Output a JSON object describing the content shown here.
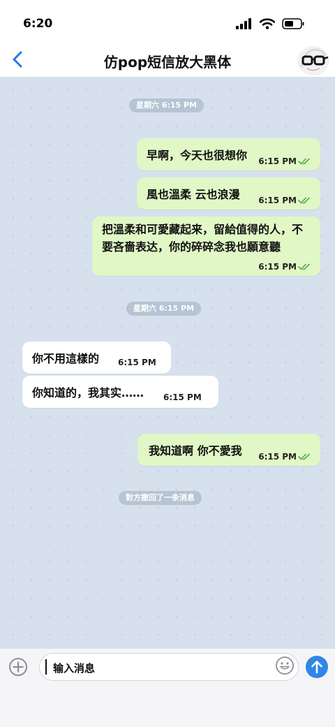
{
  "status": {
    "time": "6:20"
  },
  "header": {
    "title": "仿pop短信放大黑体"
  },
  "dates": [
    "星期六 6:15 PM",
    "星期六 6:15 PM"
  ],
  "outgoing": [
    {
      "text": "早啊，今天也很想你",
      "time": "6:15 PM"
    },
    {
      "text": "風也溫柔  云也浪漫",
      "time": "6:15 PM"
    },
    {
      "text": "把溫柔和可愛藏起来，留給值得的人，不要吝嗇表达，你的碎碎念我也願意聽",
      "time": "6:15 PM"
    },
    {
      "text": "我知道啊  你不愛我",
      "time": "6:15 PM"
    }
  ],
  "incoming": [
    {
      "text": "你不用這樣的",
      "time": "6:15 PM"
    },
    {
      "text": "你知道的，我其实……",
      "time": "6:15 PM"
    }
  ],
  "system_notice": "對方撤回了一条消息",
  "composer": {
    "input_value": "输入消息"
  },
  "colors": {
    "accent": "#2e87e6",
    "outgoing_bubble": "#e1f7c6",
    "incoming_bubble": "#ffffff",
    "chat_bg": "#d6e1ed",
    "read_check": "#4fae4a"
  },
  "icons": [
    "back-chevron-icon",
    "avatar-glasses-icon",
    "add-circle-icon",
    "emoji-icon",
    "send-arrow-icon",
    "signal-icon",
    "wifi-icon",
    "battery-icon",
    "double-check-icon"
  ]
}
